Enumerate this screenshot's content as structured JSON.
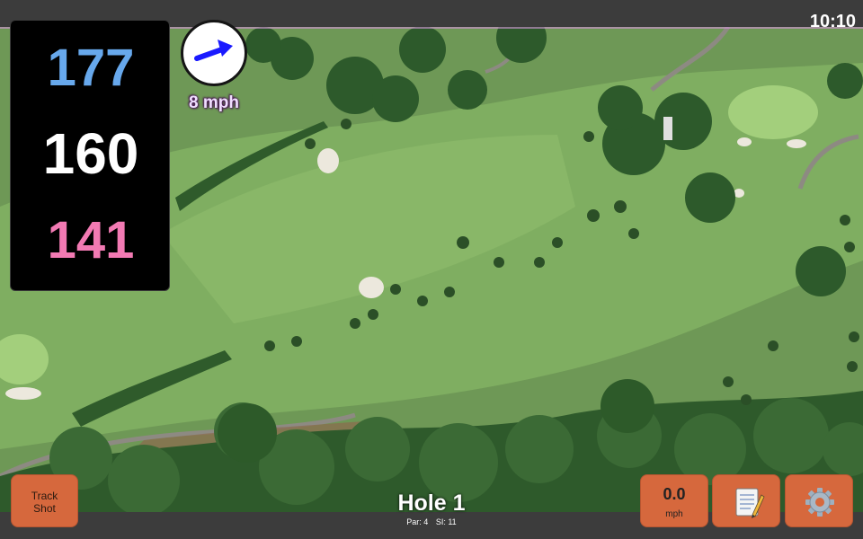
{
  "status": {
    "time": "10:10"
  },
  "distances": {
    "back": "177",
    "middle": "160",
    "front": "141",
    "back_color": "#67a8ec",
    "middle_color": "#ffffff",
    "front_color": "#f27ab3"
  },
  "wind": {
    "speed": "8 mph",
    "icon": "wind-direction-arrow-icon",
    "arrow_color": "#1a1aff"
  },
  "buttons": {
    "track_shot": "Track\nShot",
    "speed_value": "0.0",
    "speed_unit": "mph",
    "notes_icon": "notepad-icon",
    "settings_icon": "gear-icon"
  },
  "hole": {
    "title": "Hole 1",
    "par": "Par: 4",
    "si": "SI: 11"
  },
  "colors": {
    "button": "#d6683d",
    "bar": "#3c3c3c",
    "fairway": "#7fae60",
    "rough": "#6f9a57",
    "bunker": "#e9e6dc",
    "trees": "#2f5a2a"
  }
}
